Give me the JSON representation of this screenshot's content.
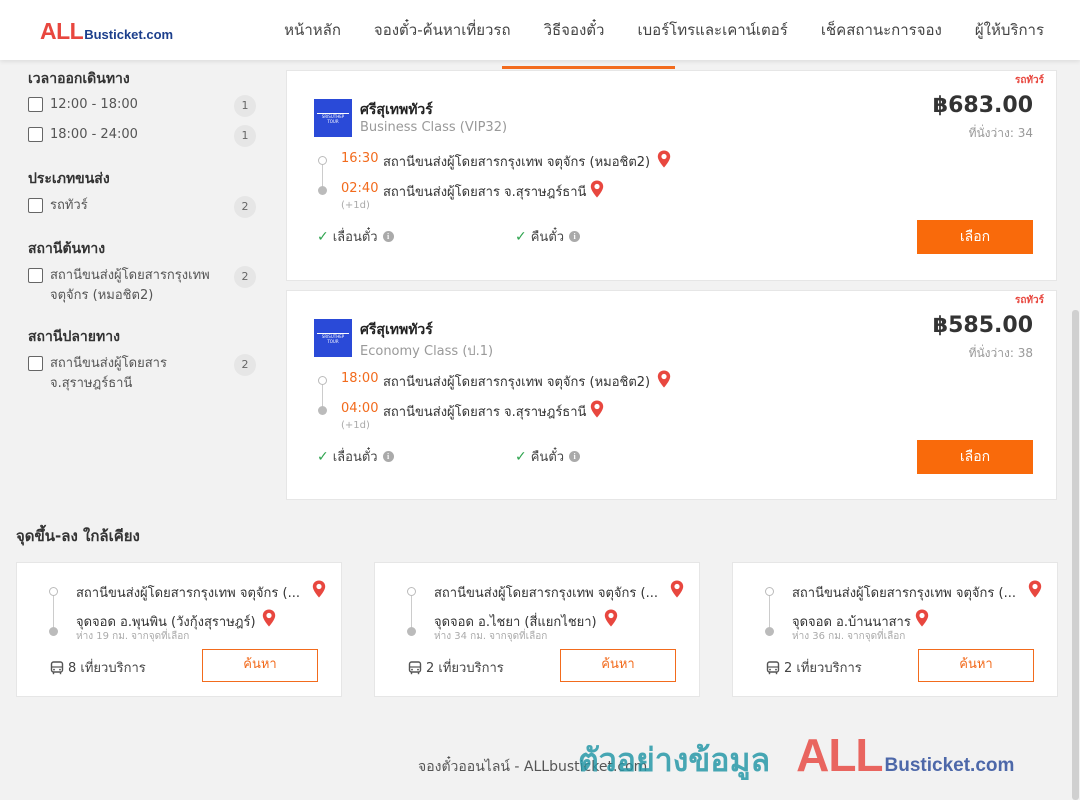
{
  "header": {
    "logo_all": "ALL",
    "logo_bus": "Busticket.com",
    "nav": [
      "หน้าหลัก",
      "จองตั๋ว-ค้นหาเที่ยวรถ",
      "วิธีจองตั๋ว",
      "เบอร์โทรและเคาน์เตอร์",
      "เช็คสถานะการจอง",
      "ผู้ให้บริการ"
    ]
  },
  "sidebar": {
    "departure_time": {
      "title": "เวลาออกเดินทาง",
      "options": [
        {
          "label": "12:00 - 18:00",
          "count": "1"
        },
        {
          "label": "18:00 - 24:00",
          "count": "1"
        }
      ]
    },
    "transport_type": {
      "title": "ประเภทขนส่ง",
      "options": [
        {
          "label": "รถทัวร์",
          "count": "2"
        }
      ]
    },
    "origin": {
      "title": "สถานีต้นทาง",
      "options": [
        {
          "label": "สถานีขนส่งผู้โดยสารกรุงเทพ จตุจักร (หมอชิต2)",
          "count": "2"
        }
      ]
    },
    "destination": {
      "title": "สถานีปลายทาง",
      "options": [
        {
          "label": "สถานีขนส่งผู้โดยสาร จ.สุราษฎร์ธานี",
          "count": "2"
        }
      ]
    }
  },
  "trips": [
    {
      "tag": "รถทัวร์",
      "operator": "ศรีสุเทพทัวร์",
      "bus_class": "Business Class (VIP32)",
      "price": "฿683.00",
      "seats": "ที่นั่งว่าง: 34",
      "depart_time": "16:30",
      "depart_station": "สถานีขนส่งผู้โดยสารกรุงเทพ จตุจักร (หมอชิต2)",
      "arrive_time": "02:40",
      "arrive_station": "สถานีขนส่งผู้โดยสาร จ.สุราษฎร์ธานี",
      "next_day": "(+1d)",
      "feature1": "เลื่อนตั๋ว",
      "feature2": "คืนตั๋ว",
      "select_label": "เลือก"
    },
    {
      "tag": "รถทัวร์",
      "operator": "ศรีสุเทพทัวร์",
      "bus_class": "Economy Class (ป.1)",
      "price": "฿585.00",
      "seats": "ที่นั่งว่าง: 38",
      "depart_time": "18:00",
      "depart_station": "สถานีขนส่งผู้โดยสารกรุงเทพ จตุจักร (หมอชิต2)",
      "arrive_time": "04:00",
      "arrive_station": "สถานีขนส่งผู้โดยสาร จ.สุราษฎร์ธานี",
      "next_day": "(+1d)",
      "feature1": "เลื่อนตั๋ว",
      "feature2": "คืนตั๋ว",
      "select_label": "เลือก"
    }
  ],
  "nearby": {
    "title": "จุดขึ้น-ลง ใกล้เคียง",
    "items": [
      {
        "from": "สถานีขนส่งผู้โดยสารกรุงเทพ จตุจักร (...",
        "to": "จุดจอด อ.พุนพิน (วังกุ้งสุราษฎร์)",
        "distance": "ห่าง 19 กม. จากจุดที่เลือก",
        "trips": "8 เที่ยวบริการ",
        "search_label": "ค้นหา"
      },
      {
        "from": "สถานีขนส่งผู้โดยสารกรุงเทพ จตุจักร (...",
        "to": "จุดจอด อ.ไชยา (สี่แยกไชยา)",
        "distance": "ห่าง 34 กม. จากจุดที่เลือก",
        "trips": "2 เที่ยวบริการ",
        "search_label": "ค้นหา"
      },
      {
        "from": "สถานีขนส่งผู้โดยสารกรุงเทพ จตุจักร (...",
        "to": "จุดจอด อ.บ้านนาสาร",
        "distance": "ห่าง 36 กม. จากจุดที่เลือก",
        "trips": "2 เที่ยวบริการ",
        "search_label": "ค้นหา"
      }
    ]
  },
  "footer": {
    "text": "จองตั๋วออนไลน์ - ALLbusticket.com"
  },
  "watermark": {
    "thai": "ตัวอย่างข้อมูล",
    "all": "ALL",
    "bus": "Busticket.com"
  },
  "colors": {
    "accent": "#f96a0b",
    "time": "#f26b1d",
    "brand_red": "#e8473f",
    "check_green": "#2ea44f"
  }
}
